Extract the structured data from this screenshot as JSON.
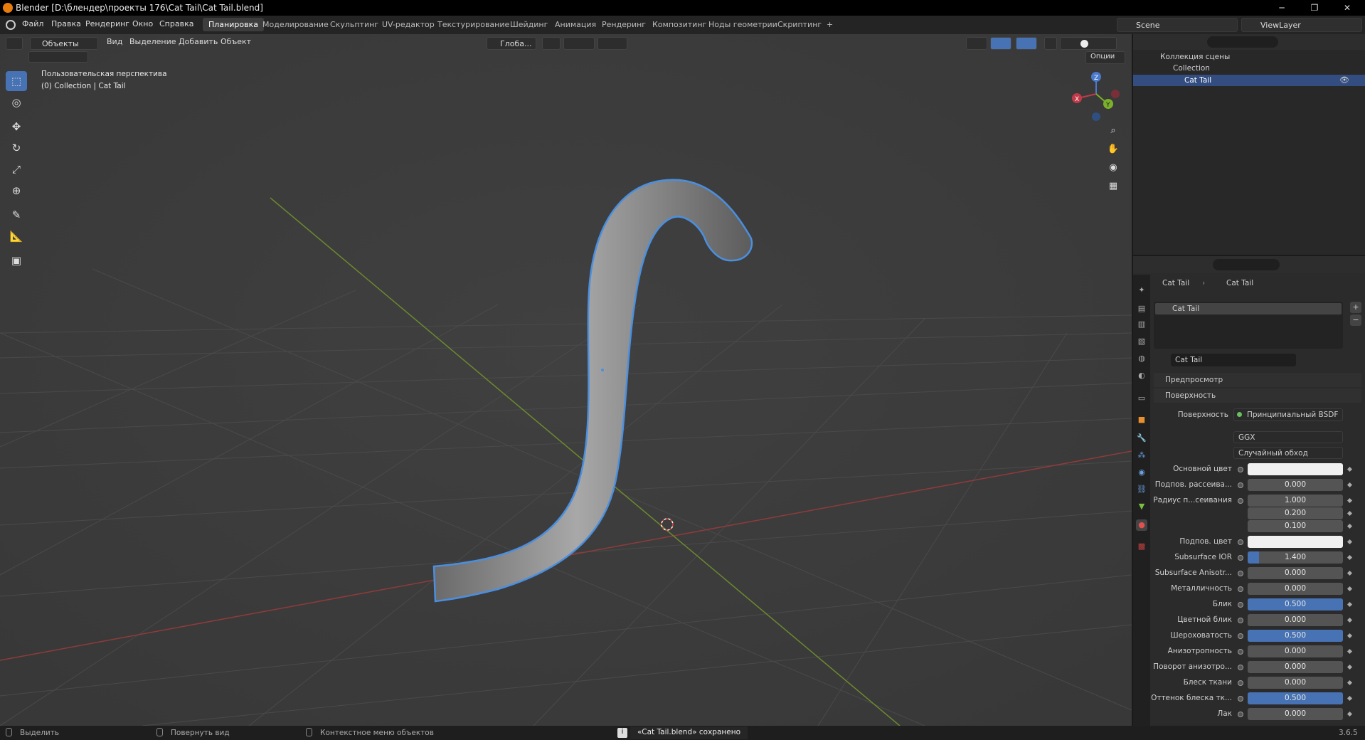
{
  "window": {
    "title": "Blender [D:\\блендер\\проекты 176\\Cat Tail\\Cat Tail.blend]",
    "min": "─",
    "max": "❐",
    "close": "✕"
  },
  "menu": [
    "Файл",
    "Правка",
    "Рендеринг",
    "Окно",
    "Справка"
  ],
  "workspaces": [
    "Планировка",
    "Моделирование",
    "Скульптинг",
    "UV-редактор",
    "Текстурирование",
    "Шейдинг",
    "Анимация",
    "Рендеринг",
    "Композитинг",
    "Ноды геометрии",
    "Скриптинг",
    "+"
  ],
  "scene": {
    "name": "Scene",
    "view_layer": "ViewLayer"
  },
  "viewport": {
    "mode": "Объекты",
    "menus": [
      "Вид",
      "Выделение",
      "Добавить",
      "Объект"
    ],
    "transform": "Глоба...",
    "options": "Опции",
    "info_line1": "Пользовательская перспектива",
    "info_line2": "(0) Collection | Cat Tail",
    "gizmo": {
      "z": "Z",
      "y": "Y",
      "x": "X"
    }
  },
  "tools": [
    "⬚",
    "◎",
    "✥",
    "↻",
    "⤢",
    "⊕",
    "✎",
    "📐",
    "▣"
  ],
  "outliner": {
    "root": "Коллекция сцены",
    "collection": "Collection",
    "object": "Cat Tail"
  },
  "properties": {
    "breadcrumb_obj": "Cat Tail",
    "breadcrumb_mat": "Cat Tail",
    "slot": "Cat Tail",
    "material_name": "Cat Tail",
    "section_preview": "Предпросмотр",
    "section_surface": "Поверхность",
    "surface_label": "Поверхность",
    "surface_value": "Принципиальный BSDF",
    "distribution": "GGX",
    "sss_method": "Случайный обход",
    "rows": [
      {
        "label": "Основной цвет",
        "value": "",
        "fill": 0,
        "color": "#f0f0f0"
      },
      {
        "label": "Подпов. рассеива...",
        "value": "0.000",
        "fill": 0
      },
      {
        "label": "Радиус п...сеивания",
        "value": "1.000",
        "fill": 0
      },
      {
        "label": "",
        "value": "0.200",
        "fill": 0
      },
      {
        "label": "",
        "value": "0.100",
        "fill": 0
      },
      {
        "label": "Подпов. цвет",
        "value": "",
        "fill": 0,
        "color": "#f0f0f0"
      },
      {
        "label": "Subsurface IOR",
        "value": "1.400",
        "fill": 0.12
      },
      {
        "label": "Subsurface Anisotr...",
        "value": "0.000",
        "fill": 0
      },
      {
        "label": "Металличность",
        "value": "0.000",
        "fill": 0
      },
      {
        "label": "Блик",
        "value": "0.500",
        "fill": 1
      },
      {
        "label": "Цветной блик",
        "value": "0.000",
        "fill": 0
      },
      {
        "label": "Шероховатость",
        "value": "0.500",
        "fill": 1
      },
      {
        "label": "Анизотропность",
        "value": "0.000",
        "fill": 0
      },
      {
        "label": "Поворот анизотро...",
        "value": "0.000",
        "fill": 0
      },
      {
        "label": "Блеск ткани",
        "value": "0.000",
        "fill": 0
      },
      {
        "label": "Оттенок блеска тк...",
        "value": "0.500",
        "fill": 1
      },
      {
        "label": "Лак",
        "value": "0.000",
        "fill": 0
      }
    ]
  },
  "status": {
    "select": "Выделить",
    "rotate": "Повернуть вид",
    "context": "Контекстное меню объектов",
    "saved": "«Cat Tail.blend» сохранено",
    "version": "3.6.5"
  }
}
